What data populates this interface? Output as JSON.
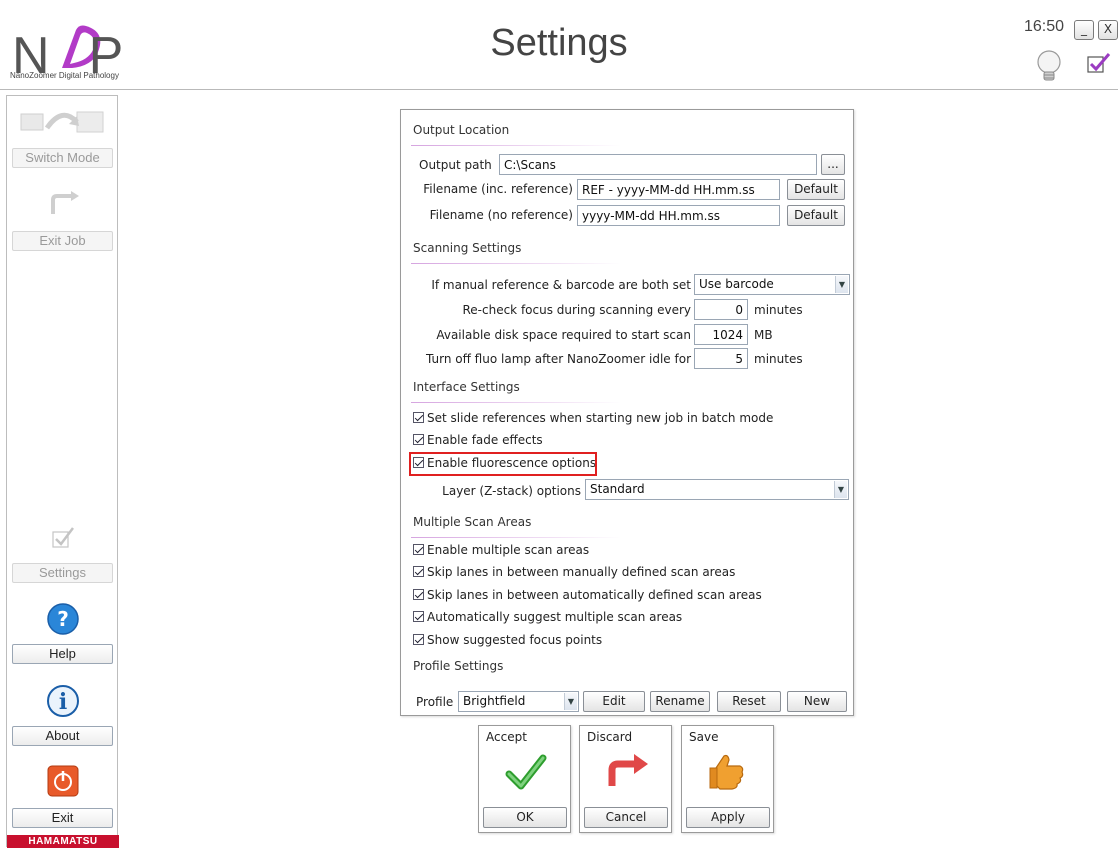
{
  "header": {
    "logo_text": "NDP",
    "logo_subtitle": "NanoZoomer Digital Pathology",
    "title": "Settings",
    "time": "16:50",
    "minimize_label": "_",
    "close_label": "X"
  },
  "sidebar": {
    "switch_mode": "Switch Mode",
    "exit_job": "Exit Job",
    "settings": "Settings",
    "help": "Help",
    "about": "About",
    "exit": "Exit",
    "brand": "HAMAMATSU"
  },
  "output_location": {
    "title": "Output Location",
    "output_path_label": "Output path",
    "output_path_value": "C:\\Scans",
    "browse_label": "...",
    "filename_ref_label": "Filename (inc. reference)",
    "filename_ref_value": "REF - yyyy-MM-dd HH.mm.ss",
    "filename_noref_label": "Filename (no reference)",
    "filename_noref_value": "yyyy-MM-dd HH.mm.ss",
    "default_label": "Default"
  },
  "scanning": {
    "title": "Scanning Settings",
    "manual_ref_label": "If manual reference & barcode are both set",
    "manual_ref_value": "Use barcode",
    "recheck_label": "Re-check focus during scanning every",
    "recheck_value": "0",
    "recheck_unit": "minutes",
    "disk_label": "Available disk space required to start scan",
    "disk_value": "1024",
    "disk_unit": "MB",
    "fluo_label": "Turn off fluo lamp after NanoZoomer idle for",
    "fluo_value": "5",
    "fluo_unit": "minutes"
  },
  "interface": {
    "title": "Interface Settings",
    "slide_refs": "Set slide references when starting new job in batch mode",
    "fade": "Enable fade effects",
    "fluorescence": "Enable fluorescence options",
    "layer_label": "Layer (Z-stack) options",
    "layer_value": "Standard"
  },
  "multiple": {
    "title": "Multiple Scan Areas",
    "enable": "Enable multiple scan areas",
    "skip_manual": "Skip lanes in between manually defined scan areas",
    "skip_auto": "Skip lanes in between automatically defined scan areas",
    "suggest": "Automatically suggest multiple scan areas",
    "focus": "Show suggested focus points"
  },
  "profile": {
    "title": "Profile Settings",
    "label": "Profile",
    "value": "Brightfield",
    "edit": "Edit",
    "rename": "Rename",
    "reset": "Reset",
    "new": "New"
  },
  "actions": {
    "accept_title": "Accept",
    "accept_btn": "OK",
    "discard_title": "Discard",
    "discard_btn": "Cancel",
    "save_title": "Save",
    "save_btn": "Apply"
  },
  "colors": {
    "accent_line": "#d6a5e0",
    "highlight": "#e02020",
    "brand": "#c8102e",
    "ok_green": "#2e9e2e",
    "discard_red": "#e04848"
  }
}
